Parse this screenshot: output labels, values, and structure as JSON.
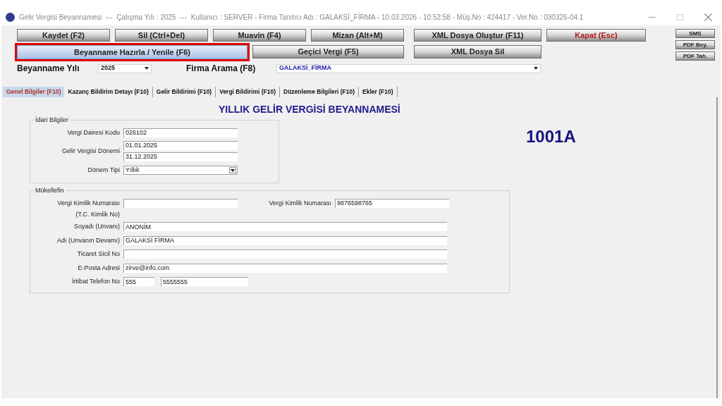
{
  "window": {
    "title": "Gelir Vergisi Beyannamesi  ---  Çalışma Yılı : 2025  ---  Kullanıcı : SERVER - Firma Tanıtıcı Adı : GALAKSİ_FİRMA - 10.03.2026 - 10:52:58 - Müş.No : 424417 - Ver.No : 030326-04.1"
  },
  "toolbar_row_1": [
    {
      "label": "Kaydet (F2)",
      "kind": "normal"
    },
    {
      "label": "Sil (Ctrl+Del)",
      "kind": "normal"
    },
    {
      "label": "Muavin (F4)",
      "kind": "normal"
    },
    {
      "label": "Mizan (Alt+M)",
      "kind": "normal"
    },
    {
      "label": "XML Dosya Oluştur (F11)",
      "kind": "wide"
    },
    {
      "label": "Kapat (Esc)",
      "kind": "danger"
    }
  ],
  "toolbar_row_2": [
    {
      "label": "Beyanname Hazırla / Yenile (F6)",
      "highlighted": true
    },
    {
      "label": "Geçici Vergi (F5)",
      "highlighted": false
    },
    {
      "label": "XML Dosya Sil",
      "highlighted": false
    }
  ],
  "side_buttons": [
    "SMS",
    "PDF Bey.",
    "PDF Tah."
  ],
  "year": {
    "label": "Beyanname Yılı",
    "value": "2025"
  },
  "firm_search": {
    "label": "Firma Arama (F8)",
    "value": "GALAKSİ_FİRMA"
  },
  "tabs": [
    {
      "label": "Genel Bilgiler (F10)",
      "selected": true
    },
    {
      "label": "Kazanç Bildirim Detayı (F10)",
      "selected": false
    },
    {
      "label": "Gelir Bildirimi (F10)",
      "selected": false
    },
    {
      "label": "Vergi Bildirimi (F10)",
      "selected": false
    },
    {
      "label": "Düzenleme Bilgileri (F10)",
      "selected": false
    },
    {
      "label": "Ekler (F10)",
      "selected": false
    }
  ],
  "form_title": "YILLIK GELİR VERGİSİ BEYANNAMESİ",
  "form_code": "1001A",
  "admin_group": {
    "title": "İdari Bilgiler",
    "tax_office_code": {
      "label": "Vergi Dairesi Kodu",
      "value": "026102"
    },
    "period": {
      "label": "Gelir Vergisi Dönemi",
      "start": "01.01.2025",
      "end": "31.12.2025"
    },
    "period_type": {
      "label": "Dönem Tipi",
      "value": "Yıllık"
    }
  },
  "taxpayer_group": {
    "title": "Mükellefin",
    "tckn": {
      "label": "Vergi Kimlik Numarası",
      "sublabel": "(T.C. Kimlik No)"
    },
    "vkn": {
      "label": "Vergi Kimlik Numarası",
      "value": "9876598765"
    },
    "fields": [
      {
        "label": "Soyadı (Unvanı)",
        "value": "ANONİM"
      },
      {
        "label": "Adı (Unvanın Devamı)",
        "value": "GALAKSİ FİRMA"
      },
      {
        "label": "Ticaret Sicil No"
      },
      {
        "label": "E-Posta Adresi",
        "value": "zirve@info.com"
      }
    ],
    "phone": {
      "label": "İrtibat Telefon No",
      "area": "555",
      "number": "5555555"
    }
  }
}
